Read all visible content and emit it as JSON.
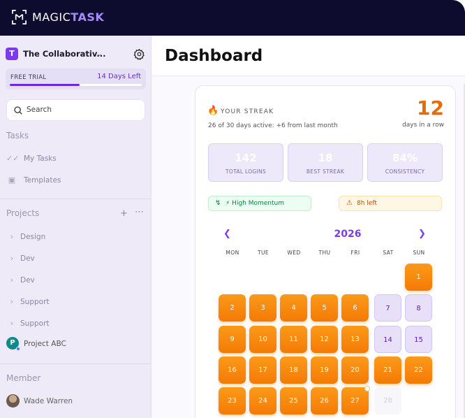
{
  "brand": {
    "prefix": "MAGIC",
    "suffix": "TASK"
  },
  "workspace": {
    "initial": "T",
    "name": "The Collaborativ..."
  },
  "trial": {
    "label": "FREE TRIAL",
    "days_left": "14 Days Left",
    "progress": 0.53
  },
  "search": {
    "placeholder": "Search"
  },
  "sidebar": {
    "tasks_heading": "Tasks",
    "tasks": [
      {
        "label": "My Tasks",
        "icon": "check-icon"
      },
      {
        "label": "Templates",
        "icon": "template-icon"
      }
    ],
    "projects_heading": "Projects",
    "projects": [
      {
        "label": "Design"
      },
      {
        "label": "Dev"
      },
      {
        "label": "Dev"
      },
      {
        "label": "Support"
      },
      {
        "label": "Support"
      }
    ],
    "project_abc": {
      "initial": "P",
      "label": "Project ABC"
    },
    "member_heading": "Member",
    "members": [
      {
        "name": "Wade Warren"
      }
    ]
  },
  "main": {
    "title": "Dashboard"
  },
  "streak": {
    "title": "YOUR STREAK",
    "subtitle": "26 of 30 days active: +6 from last month",
    "count": "12",
    "unit": "days in a row",
    "stats": [
      {
        "value": "142",
        "label": "TOTAL LOGINS"
      },
      {
        "value": "18",
        "label": "BEST STREAK"
      },
      {
        "value": "84%",
        "label": "CONSISTENCY"
      }
    ],
    "badges": {
      "momentum": "⚡ High Momentum",
      "time_left": "8h left"
    }
  },
  "calendar": {
    "year": "2026",
    "weekdays": [
      "MON",
      "TUE",
      "WED",
      "THU",
      "FRI",
      "SAT",
      "SUN"
    ],
    "rows": [
      [
        null,
        null,
        null,
        null,
        null,
        null,
        {
          "d": "1",
          "s": "active"
        }
      ],
      [
        {
          "d": "2",
          "s": "active"
        },
        {
          "d": "3",
          "s": "active"
        },
        {
          "d": "4",
          "s": "active"
        },
        {
          "d": "5",
          "s": "active"
        },
        {
          "d": "6",
          "s": "active"
        },
        {
          "d": "7",
          "s": "weekend"
        },
        {
          "d": "8",
          "s": "weekend"
        }
      ],
      [
        {
          "d": "9",
          "s": "active"
        },
        {
          "d": "10",
          "s": "active"
        },
        {
          "d": "11",
          "s": "active"
        },
        {
          "d": "12",
          "s": "active"
        },
        {
          "d": "13",
          "s": "active"
        },
        {
          "d": "14",
          "s": "weekend"
        },
        {
          "d": "15",
          "s": "weekend"
        }
      ],
      [
        {
          "d": "16",
          "s": "active"
        },
        {
          "d": "17",
          "s": "active"
        },
        {
          "d": "18",
          "s": "active"
        },
        {
          "d": "19",
          "s": "active"
        },
        {
          "d": "20",
          "s": "active"
        },
        {
          "d": "21",
          "s": "active"
        },
        {
          "d": "22",
          "s": "active"
        }
      ],
      [
        {
          "d": "23",
          "s": "active"
        },
        {
          "d": "24",
          "s": "active"
        },
        {
          "d": "25",
          "s": "active"
        },
        {
          "d": "26",
          "s": "active"
        },
        {
          "d": "27",
          "s": "active"
        },
        {
          "d": "28",
          "s": "future"
        },
        null
      ]
    ]
  },
  "colors": {
    "accent": "#7c3aed",
    "streak_orange": "#f47a05",
    "topbar": "#0d0b2e"
  }
}
